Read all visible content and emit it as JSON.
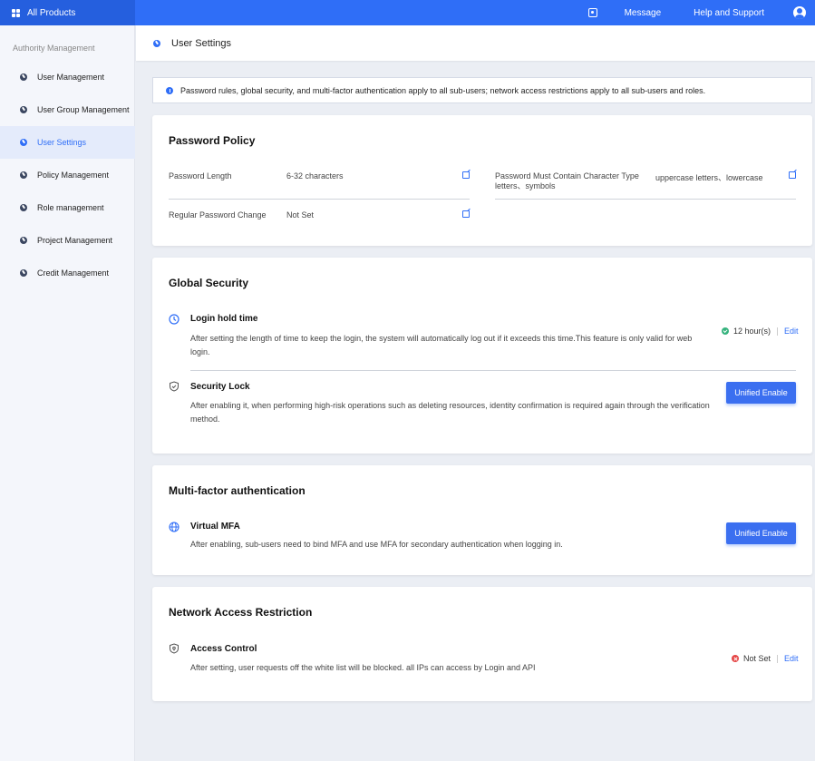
{
  "topbar": {
    "brand": "All Products",
    "message": "Message",
    "help": "Help and Support"
  },
  "sidebar": {
    "section": "Authority Management",
    "items": [
      {
        "label": "User Management"
      },
      {
        "label": "User Group Management"
      },
      {
        "label": "User Settings",
        "active": true
      },
      {
        "label": "Policy Management"
      },
      {
        "label": "Role management"
      },
      {
        "label": "Project Management"
      },
      {
        "label": "Credit Management"
      }
    ]
  },
  "page": {
    "title": "User Settings",
    "notice": "Password rules, global security, and multi-factor authentication apply to all sub-users; network access restrictions apply to all sub-users and roles."
  },
  "password_policy": {
    "title": "Password Policy",
    "length_label": "Password Length",
    "length_value": "6-32 characters",
    "char_type_label": "Password Must Contain Character Type",
    "char_type_value_line1": "uppercase letters、lowercase",
    "char_type_value_line2": "letters、symbols",
    "change_label": "Regular Password Change",
    "change_value": "Not Set"
  },
  "global_security": {
    "title": "Global Security",
    "login_hold": {
      "title": "Login hold time",
      "desc_line1": "After setting the length of time to keep the login, the system will automatically log out if it exceeds this time.This feature is only valid for web",
      "desc_line2": "login.",
      "status": "12 hour(s)",
      "edit": "Edit"
    },
    "security_lock": {
      "title": "Security Lock",
      "desc_line1": "After enabling it, when performing high-risk operations such as deleting resources, identity confirmation is required again through the verification",
      "desc_line2": "method.",
      "button": "Unified Enable"
    }
  },
  "mfa": {
    "title": "Multi-factor authentication",
    "virtual_mfa": {
      "title": "Virtual MFA",
      "desc": "After enabling, sub-users need to bind MFA and use MFA for secondary authentication when logging in.",
      "button": "Unified Enable"
    }
  },
  "network": {
    "title": "Network Access Restriction",
    "access_control": {
      "title": "Access Control",
      "desc": "After setting, user requests off the white list will be blocked. all IPs can access by Login and API",
      "status": "Not Set",
      "edit": "Edit"
    }
  },
  "colors": {
    "primary": "#2f6ef7",
    "success": "#36b37e",
    "error": "#e54545"
  }
}
